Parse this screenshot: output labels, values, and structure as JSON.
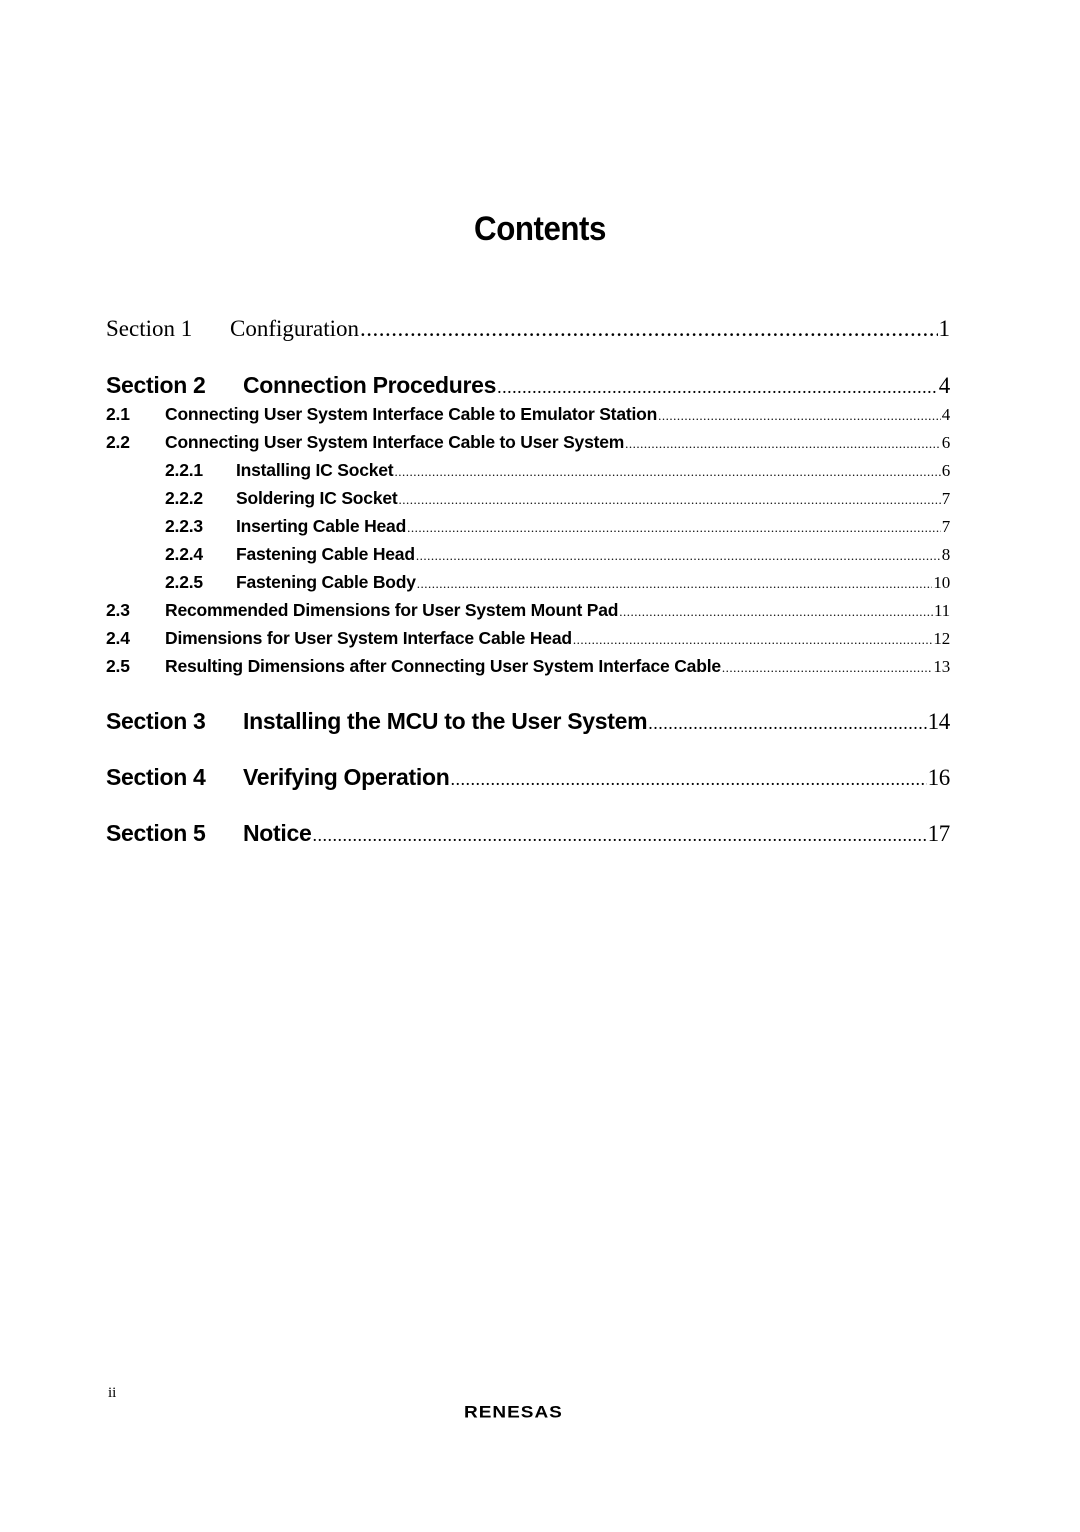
{
  "title": "Contents",
  "entries": [
    {
      "level": "section-plain",
      "number": "Section 1",
      "label": "Configuration",
      "page": "1"
    },
    {
      "level": "section",
      "number": "Section 2",
      "label": "Connection Procedures",
      "page": "4"
    },
    {
      "level": "sub",
      "number": "2.1",
      "label": "Connecting User System Interface Cable to Emulator Station",
      "page": "4"
    },
    {
      "level": "sub",
      "number": "2.2",
      "label": "Connecting User System Interface Cable to User System",
      "page": "6"
    },
    {
      "level": "subsub",
      "number": "2.2.1",
      "label": "Installing IC Socket",
      "page": "6"
    },
    {
      "level": "subsub",
      "number": "2.2.2",
      "label": "Soldering IC Socket",
      "page": "7"
    },
    {
      "level": "subsub",
      "number": "2.2.3",
      "label": "Inserting Cable Head",
      "page": "7"
    },
    {
      "level": "subsub",
      "number": "2.2.4",
      "label": "Fastening Cable Head",
      "page": "8"
    },
    {
      "level": "subsub",
      "number": "2.2.5",
      "label": "Fastening Cable Body",
      "page": "10"
    },
    {
      "level": "sub",
      "number": "2.3",
      "label": "Recommended Dimensions for User System Mount Pad",
      "page": "11"
    },
    {
      "level": "sub",
      "number": "2.4",
      "label": "Dimensions for User System Interface Cable Head",
      "page": "12"
    },
    {
      "level": "sub",
      "number": "2.5",
      "label": "Resulting Dimensions after Connecting User System Interface Cable",
      "page": "13"
    },
    {
      "level": "section",
      "number": "Section 3",
      "label": "Installing the MCU to the User System",
      "page": "14"
    },
    {
      "level": "section",
      "number": "Section 4",
      "label": "Verifying Operation",
      "page": "16"
    },
    {
      "level": "section",
      "number": "Section 5",
      "label": "Notice",
      "page": "17"
    }
  ],
  "footer": {
    "page_number": "ii",
    "logo_text": "RENESAS"
  }
}
